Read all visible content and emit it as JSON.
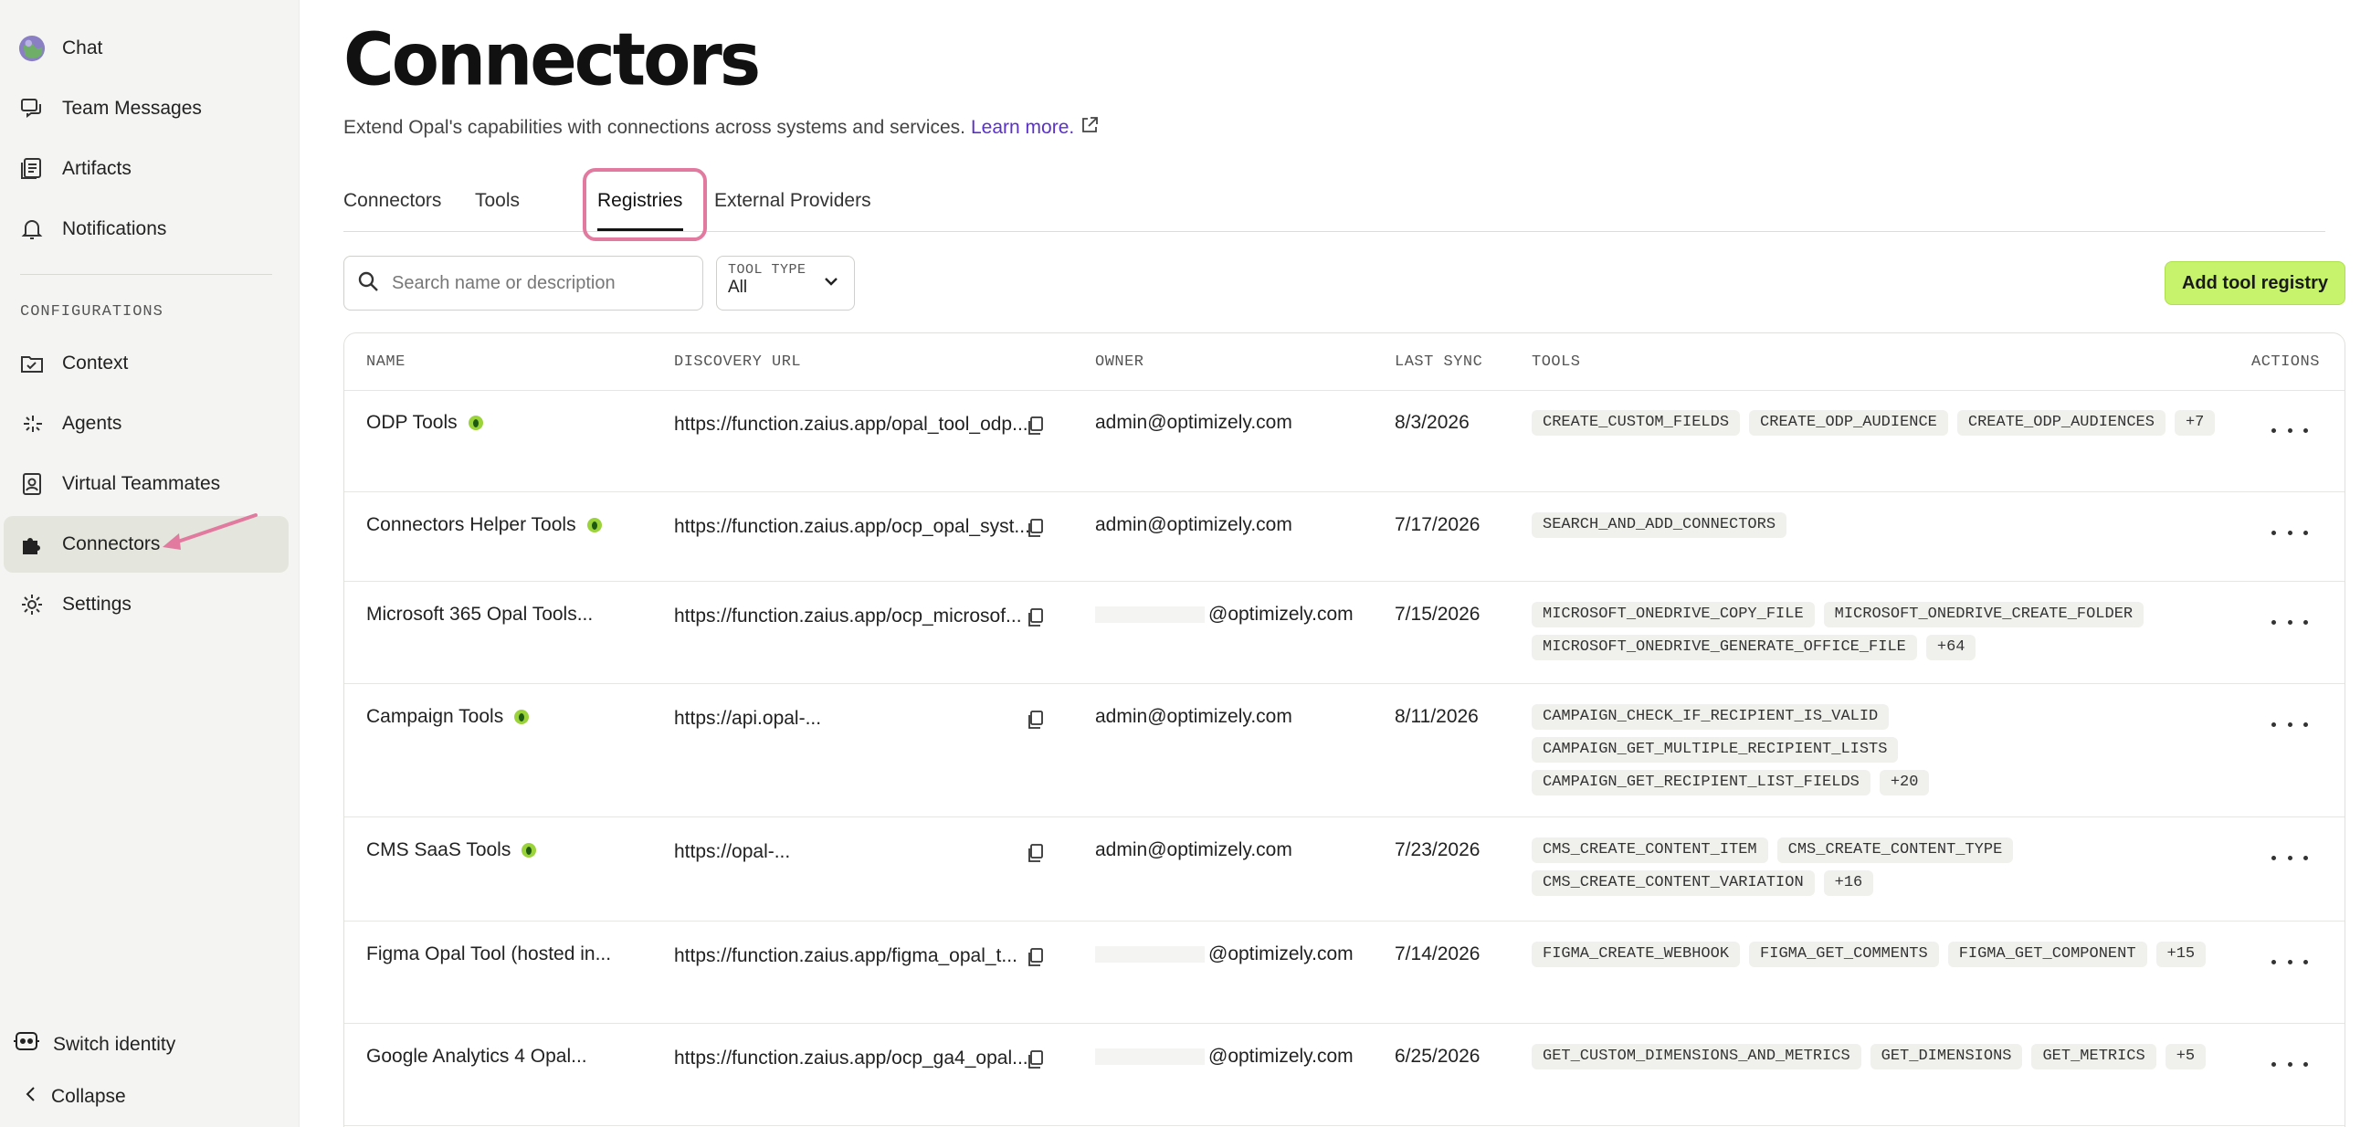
{
  "sidebar": {
    "items": [
      {
        "label": "Chat",
        "icon": "globe-avatar-icon"
      },
      {
        "label": "Team Messages",
        "icon": "messages-icon"
      },
      {
        "label": "Artifacts",
        "icon": "artifacts-icon"
      },
      {
        "label": "Notifications",
        "icon": "bell-icon"
      }
    ],
    "section_label": "CONFIGURATIONS",
    "config_items": [
      {
        "label": "Context",
        "icon": "folder-check-icon"
      },
      {
        "label": "Agents",
        "icon": "sparkle-icon"
      },
      {
        "label": "Virtual Teammates",
        "icon": "person-badge-icon"
      },
      {
        "label": "Connectors",
        "icon": "puzzle-icon",
        "active": true
      },
      {
        "label": "Settings",
        "icon": "gear-icon"
      }
    ],
    "switch_identity": "Switch identity",
    "collapse": "Collapse",
    "accent_arrow_color": "#e27aa0"
  },
  "header": {
    "title": "Connectors",
    "subtitle": "Extend Opal's capabilities with connections across systems and services.",
    "learn_more": "Learn more."
  },
  "tabs": [
    "Connectors",
    "Tools",
    "Registries",
    "External Providers"
  ],
  "active_tab": "Registries",
  "filters": {
    "search_placeholder": "Search name or description",
    "tool_type_label": "TOOL TYPE",
    "tool_type_value": "All",
    "add_button": "Add tool registry",
    "add_button_color": "#c6f36b"
  },
  "table": {
    "columns": [
      "NAME",
      "DISCOVERY URL",
      "OWNER",
      "LAST SYNC",
      "TOOLS",
      "ACTIONS"
    ],
    "rows": [
      {
        "name": "ODP Tools",
        "verified": true,
        "url": "https://function.zaius.app/opal_tool_odp...",
        "owner": "admin@optimizely.com",
        "redacted": false,
        "sync": "8/3/2026",
        "tools": [
          "CREATE_CUSTOM_FIELDS",
          "CREATE_ODP_AUDIENCE",
          "CREATE_ODP_AUDIENCES",
          "+7"
        ]
      },
      {
        "name": "Connectors Helper Tools",
        "verified": true,
        "url": "https://function.zaius.app/ocp_opal_syst...",
        "owner": "admin@optimizely.com",
        "redacted": false,
        "sync": "7/17/2026",
        "tools": [
          "SEARCH_AND_ADD_CONNECTORS"
        ]
      },
      {
        "name": "Microsoft 365 Opal Tools...",
        "verified": false,
        "url": "https://function.zaius.app/ocp_microsof...",
        "owner": "@optimizely.com",
        "redacted": true,
        "sync": "7/15/2026",
        "tools": [
          "MICROSOFT_ONEDRIVE_COPY_FILE",
          "MICROSOFT_ONEDRIVE_CREATE_FOLDER",
          "MICROSOFT_ONEDRIVE_GENERATE_OFFICE_FILE",
          "+64"
        ]
      },
      {
        "name": "Campaign Tools",
        "verified": true,
        "url": "https://api.opal-...",
        "owner": "admin@optimizely.com",
        "redacted": false,
        "sync": "8/11/2026",
        "tools": [
          "CAMPAIGN_CHECK_IF_RECIPIENT_IS_VALID",
          "CAMPAIGN_GET_MULTIPLE_RECIPIENT_LISTS",
          "CAMPAIGN_GET_RECIPIENT_LIST_FIELDS",
          "+20"
        ]
      },
      {
        "name": "CMS SaaS Tools",
        "verified": true,
        "url": "https://opal-...",
        "owner": "admin@optimizely.com",
        "redacted": false,
        "sync": "7/23/2026",
        "tools": [
          "CMS_CREATE_CONTENT_ITEM",
          "CMS_CREATE_CONTENT_TYPE",
          "CMS_CREATE_CONTENT_VARIATION",
          "+16"
        ]
      },
      {
        "name": "Figma Opal Tool (hosted in...",
        "verified": false,
        "url": "https://function.zaius.app/figma_opal_t...",
        "owner": "@optimizely.com",
        "redacted": true,
        "sync": "7/14/2026",
        "tools": [
          "FIGMA_CREATE_WEBHOOK",
          "FIGMA_GET_COMMENTS",
          "FIGMA_GET_COMPONENT",
          "+15"
        ]
      },
      {
        "name": "Google Analytics 4 Opal...",
        "verified": false,
        "url": "https://function.zaius.app/ocp_ga4_opal...",
        "owner": "@optimizely.com",
        "redacted": true,
        "sync": "6/25/2026",
        "tools": [
          "GET_CUSTOM_DIMENSIONS_AND_METRICS",
          "GET_DIMENSIONS",
          "GET_METRICS",
          "+5"
        ]
      }
    ]
  }
}
